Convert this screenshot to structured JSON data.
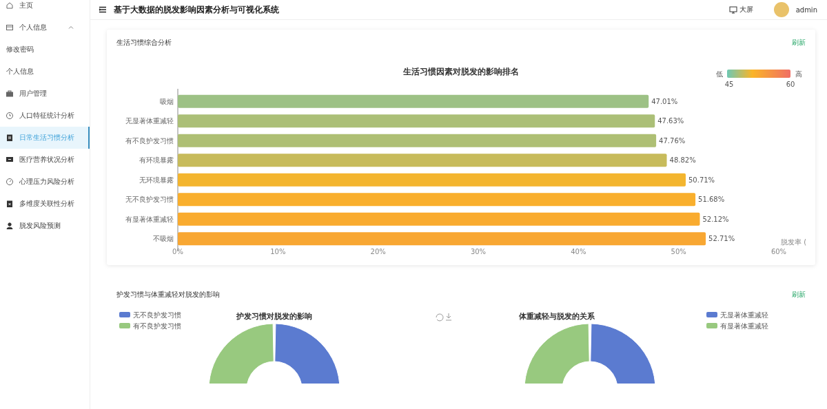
{
  "sidebar": {
    "items": [
      {
        "label": "主页",
        "selected": false
      },
      {
        "label": "个人信息",
        "selected": false,
        "expanded": true,
        "children": [
          {
            "label": "修改密码",
            "selected": false
          },
          {
            "label": "个人信息",
            "selected": false
          }
        ]
      },
      {
        "label": "用户管理",
        "selected": false
      },
      {
        "label": "人口特征统计分析",
        "selected": false
      },
      {
        "label": "日常生活习惯分析",
        "selected": true
      },
      {
        "label": "医疗营养状况分析",
        "selected": false
      },
      {
        "label": "心理压力风险分析",
        "selected": false
      },
      {
        "label": "多维度关联性分析",
        "selected": false
      },
      {
        "label": "脱发风险预测",
        "selected": false
      }
    ]
  },
  "header": {
    "title": "基于大数据的脱发影响因素分析与可视化系统",
    "screen_button": "大屏",
    "user": "admin"
  },
  "panel_1": {
    "title": "生活习惯综合分析",
    "refresh": "刷新",
    "chart_data": {
      "type": "bar",
      "orientation": "horizontal",
      "title": "生活习惯因素对脱发的影响排名",
      "xlabel": "脱发率 (",
      "categories": [
        "吸烟",
        "无显著体重减轻",
        "有不良护发习惯",
        "有环境暴露",
        "无环境暴露",
        "无不良护发习惯",
        "有显著体重减轻",
        "不吸烟"
      ],
      "values": [
        47.01,
        47.63,
        47.76,
        48.82,
        50.71,
        51.68,
        52.12,
        52.71
      ],
      "value_labels": [
        "47.01%",
        "47.63%",
        "47.76%",
        "48.82%",
        "50.71%",
        "51.68%",
        "52.12%",
        "52.71%"
      ],
      "xlim": [
        0,
        60
      ],
      "xticks": [
        {
          "value": 0,
          "label": "0%"
        },
        {
          "value": 10,
          "label": "10%"
        },
        {
          "value": 20,
          "label": "20%"
        },
        {
          "value": 30,
          "label": "30%"
        },
        {
          "value": 40,
          "label": "40%"
        },
        {
          "value": 50,
          "label": "50%"
        },
        {
          "value": 60,
          "label": "60%"
        }
      ]
    },
    "visual_map": {
      "low_label": "低",
      "high_label": "高",
      "min": "45",
      "max": "60"
    }
  },
  "panel_2": {
    "title": "护发习惯与体重减轻对脱发的影响",
    "refresh": "刷新",
    "charts": [
      {
        "title": "护发习惯对脱发的影响",
        "legend": [
          {
            "label": "无不良护发习惯",
            "color": "#5b7bd0"
          },
          {
            "label": "有不良护发习惯",
            "color": "#98c97f"
          }
        ]
      },
      {
        "title": "体重减轻与脱发的关系",
        "legend": [
          {
            "label": "无显著体重减轻",
            "color": "#5b7bd0"
          },
          {
            "label": "有显著体重减轻",
            "color": "#98c97f"
          }
        ]
      }
    ]
  }
}
